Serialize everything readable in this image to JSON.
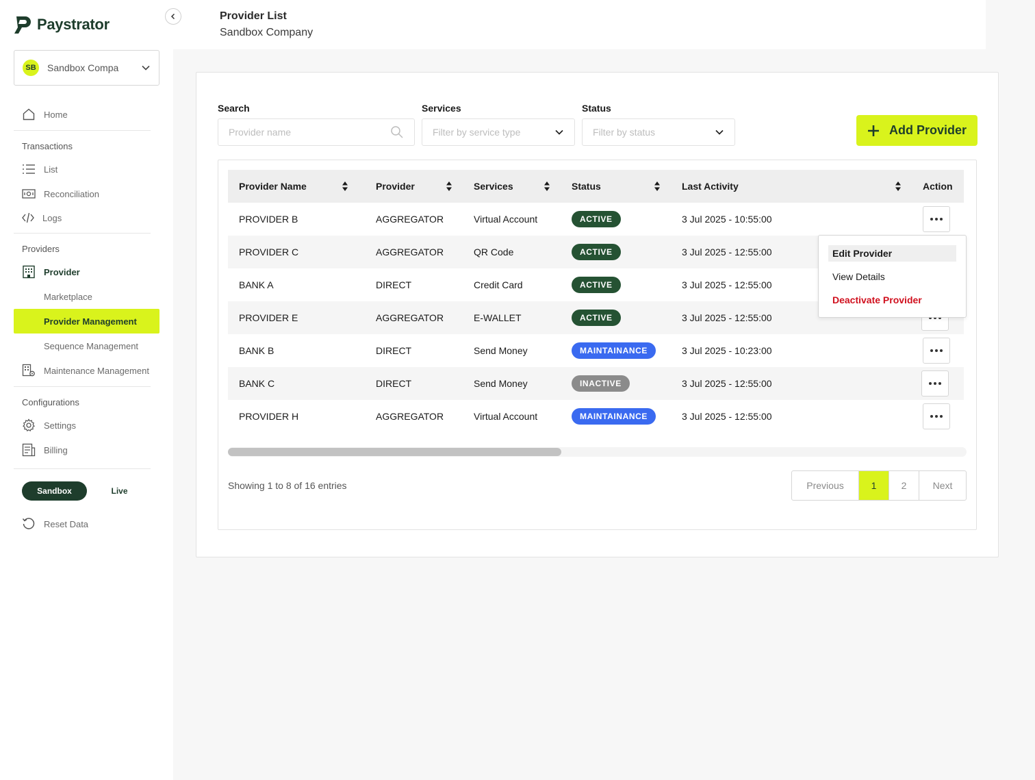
{
  "app": {
    "name": "Paystrator"
  },
  "header": {
    "title": "Provider List",
    "subtitle": "Sandbox Company"
  },
  "sidebar": {
    "company": {
      "initials": "SB",
      "name": "Sandbox Compa"
    },
    "home": "Home",
    "transactions": {
      "section": "Transactions",
      "list": "List",
      "reconciliation": "Reconciliation",
      "logs": "Logs"
    },
    "providers": {
      "section": "Providers",
      "provider": "Provider",
      "marketplace": "Marketplace",
      "provider_management": "Provider Management",
      "sequence_management": "Sequence Management",
      "maintenance_management": "Maintenance Management"
    },
    "configurations": {
      "section": "Configurations",
      "settings": "Settings",
      "billing": "Billing"
    },
    "env": {
      "sandbox": "Sandbox",
      "live": "Live"
    },
    "reset": "Reset Data"
  },
  "filters": {
    "search_label": "Search",
    "search_placeholder": "Provider name",
    "services_label": "Services",
    "services_placeholder": "Filter by service type",
    "status_label": "Status",
    "status_placeholder": "Filter by status",
    "add_button": "Add Provider"
  },
  "table": {
    "columns": [
      "Provider Name",
      "Provider",
      "Services",
      "Status",
      "Last Activity",
      "Action"
    ],
    "rows": [
      {
        "name": "PROVIDER B",
        "provider": "AGGREGATOR",
        "services": "Virtual Account",
        "status": "ACTIVE",
        "last": "3 Jul 2025 - 10:55:00"
      },
      {
        "name": "PROVIDER C",
        "provider": "AGGREGATOR",
        "services": "QR Code",
        "status": "ACTIVE",
        "last": "3 Jul 2025 - 12:55:00"
      },
      {
        "name": "BANK A",
        "provider": "DIRECT",
        "services": "Credit Card",
        "status": "ACTIVE",
        "last": "3 Jul 2025 - 12:55:00"
      },
      {
        "name": "PROVIDER E",
        "provider": "AGGREGATOR",
        "services": "E-WALLET",
        "status": "ACTIVE",
        "last": "3 Jul 2025 - 12:55:00"
      },
      {
        "name": "BANK B",
        "provider": "DIRECT",
        "services": "Send Money",
        "status": "MAINTAINANCE",
        "last": "3 Jul 2025 - 10:23:00"
      },
      {
        "name": "BANK C",
        "provider": "DIRECT",
        "services": "Send Money",
        "status": "INACTIVE",
        "last": "3 Jul 2025 - 12:55:00"
      },
      {
        "name": "PROVIDER H",
        "provider": "AGGREGATOR",
        "services": "Virtual Account",
        "status": "MAINTAINANCE",
        "last": "3 Jul 2025 - 12:55:00"
      }
    ],
    "status_colors": {
      "ACTIVE": "#255233",
      "MAINTAINANCE": "#3a6af0",
      "INACTIVE": "#8b8b8b"
    }
  },
  "menu": {
    "edit": "Edit Provider",
    "view": "View Details",
    "deactivate": "Deactivate Provider"
  },
  "footer": {
    "entries": "Showing 1 to 8 of 16 entries",
    "previous": "Previous",
    "page1": "1",
    "page2": "2",
    "next": "Next"
  },
  "colors": {
    "brand": "#1e3d2c",
    "accent": "#d9f31c",
    "danger": "#d0101e"
  }
}
